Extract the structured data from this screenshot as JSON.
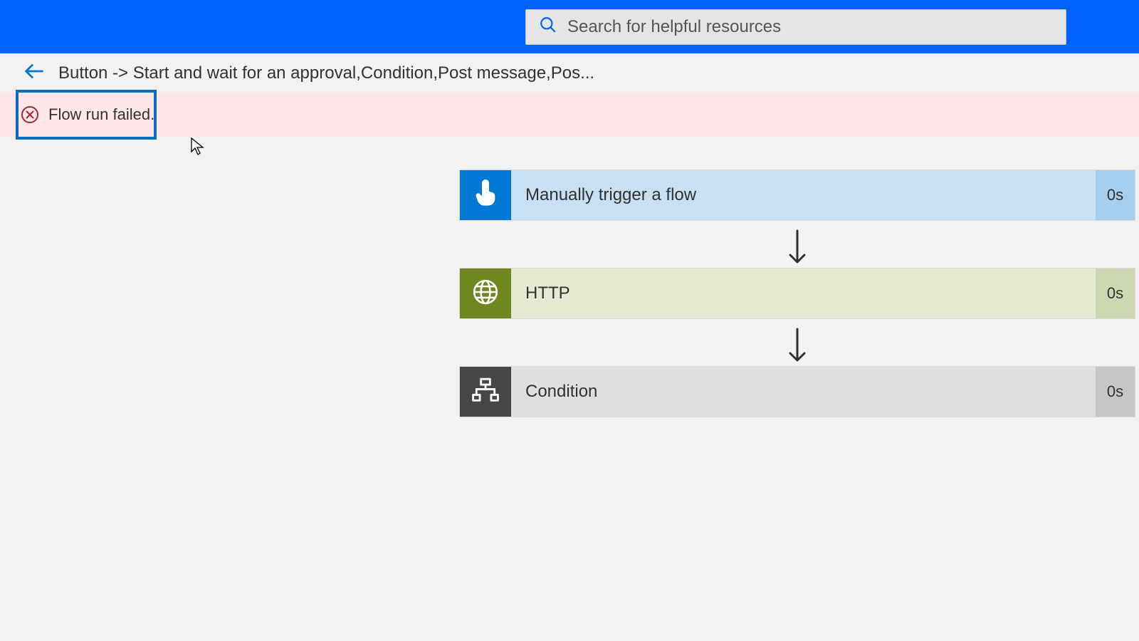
{
  "search": {
    "placeholder": "Search for helpful resources"
  },
  "breadcrumb": {
    "title": "Button -> Start and wait for an approval,Condition,Post message,Pos..."
  },
  "error": {
    "message": "Flow run failed."
  },
  "flow": {
    "steps": [
      {
        "label": "Manually trigger a flow",
        "duration": "0s"
      },
      {
        "label": "HTTP",
        "duration": "0s"
      },
      {
        "label": "Condition",
        "duration": "0s"
      }
    ]
  }
}
